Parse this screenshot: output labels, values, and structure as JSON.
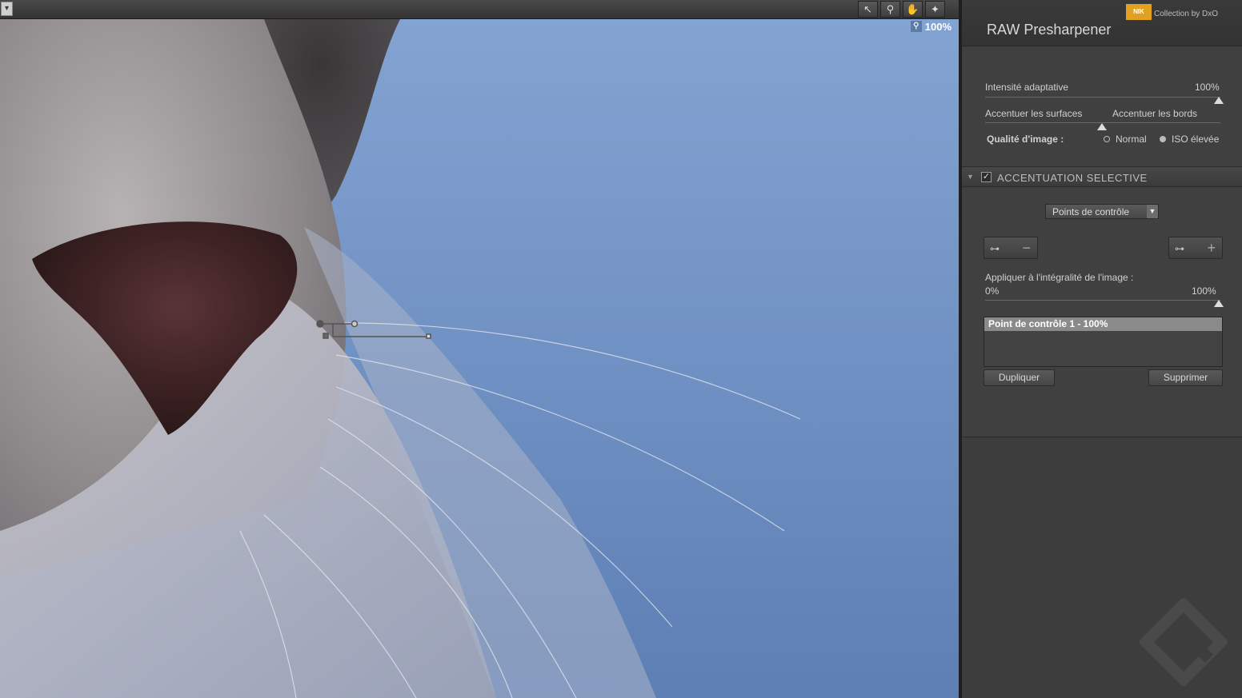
{
  "toolbar": {
    "menu_icon": "chevron-down-icon",
    "tools": [
      "pointer-icon",
      "zoom-icon",
      "hand-icon",
      "light-icon"
    ]
  },
  "canvas": {
    "zoom_label": "100%"
  },
  "panel": {
    "title": "RAW Presharpener",
    "brand": "Collection by DxO",
    "brand_logo": "NIK",
    "adaptive": {
      "label": "Intensité adaptative",
      "value": "100%"
    },
    "surfaces_label": "Accentuer les surfaces",
    "edges_label": "Accentuer les bords",
    "quality": {
      "label": "Qualité d'image :",
      "options": [
        "Normal",
        "ISO élevée"
      ],
      "selected": "ISO élevée"
    },
    "selective": {
      "title": "ACCENTUATION SELECTIVE",
      "enabled": true,
      "mode": "Points de contrôle",
      "apply_label": "Appliquer à l'intégralité de l'image :",
      "apply_min": "0%",
      "apply_max": "100%",
      "list_items": [
        "Point de contrôle 1 - 100%"
      ],
      "duplicate_label": "Dupliquer",
      "delete_label": "Supprimer"
    }
  },
  "colors": {
    "panel_bg": "#404040",
    "sky": "#6f8fbf",
    "brand_accent": "#e0a020"
  }
}
